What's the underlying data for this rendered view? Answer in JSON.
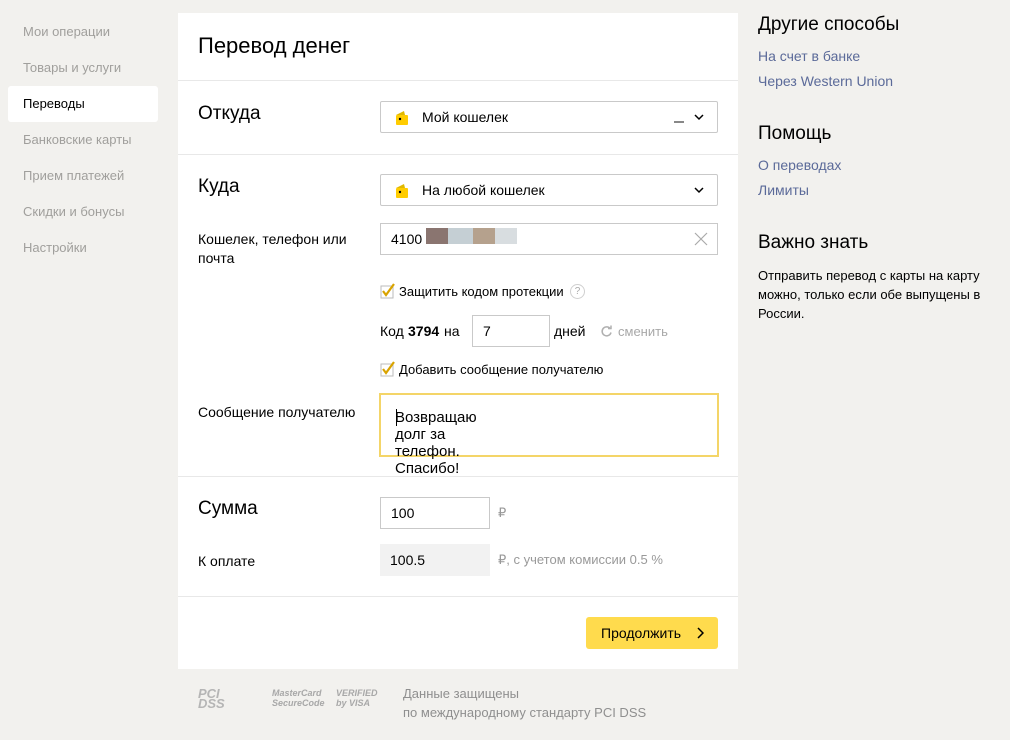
{
  "sidebar": {
    "items": [
      {
        "label": "Мои операции"
      },
      {
        "label": "Товары и услуги"
      },
      {
        "label": "Переводы"
      },
      {
        "label": "Банковские карты"
      },
      {
        "label": "Прием платежей"
      },
      {
        "label": "Скидки и бонусы"
      },
      {
        "label": "Настройки"
      }
    ]
  },
  "form": {
    "title": "Перевод денег",
    "from_label": "Откуда",
    "from_value": "Мой кошелек",
    "to_label": "Куда",
    "to_value": "На любой кошелек",
    "recipient_label": "Кошелек, телефон или почта",
    "recipient_value": "4100",
    "protect_label": "Защитить кодом протекции",
    "protect_checked": true,
    "help_glyph": "?",
    "code_prefix": "Код",
    "code_value": "3794",
    "code_on": "на",
    "days_value": "7",
    "days_label": "дней",
    "change_label": "сменить",
    "add_message_label": "Добавить сообщение получателю",
    "add_message_checked": true,
    "message_label": "Сообщение получателю",
    "message_value": "Возвращаю долг за телефон. Спасибо!",
    "sum_label": "Сумма",
    "sum_value": "100",
    "currency": "₽",
    "pay_label": "К оплате",
    "pay_value": "100.5",
    "commission_text": "₽, с учетом комиссии 0.5 %",
    "continue_label": "Продолжить"
  },
  "footer": {
    "logos": [
      "PCI DSS",
      "MasterCard SecureCode",
      "VERIFIED by VISA"
    ],
    "text_line1": "Данные защищены",
    "text_line2": "по международному стандарту PCI DSS"
  },
  "right": {
    "other_title": "Другие способы",
    "other_links": [
      "На счет в банке",
      "Через Western Union"
    ],
    "help_title": "Помощь",
    "help_links": [
      "О переводах",
      "Лимиты"
    ],
    "important_title": "Важно знать",
    "important_text": "Отправить перевод с карты на карту можно, только если обе выпущены в России."
  },
  "colors": {
    "accent_yellow": "#ffdb4d",
    "link": "#5b6a99",
    "focus_border": "#f4d568",
    "muted": "#a09f9c"
  }
}
